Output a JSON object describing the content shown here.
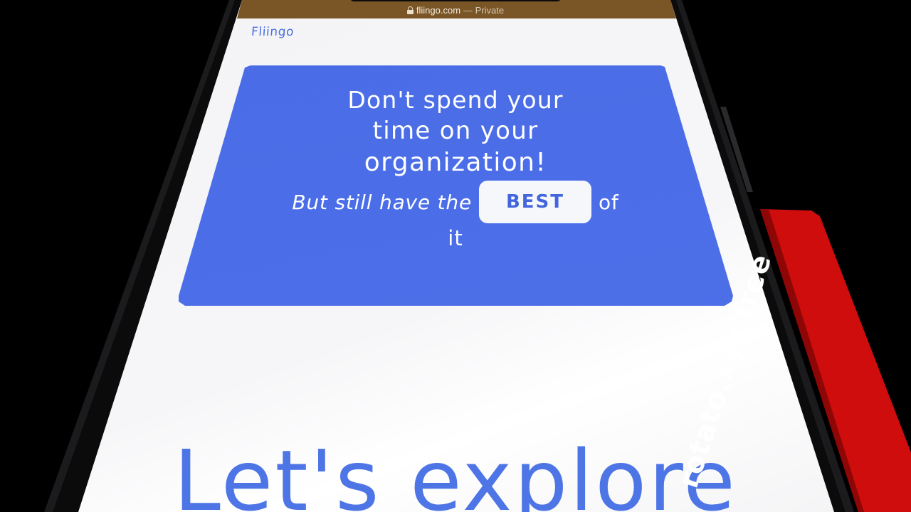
{
  "browser": {
    "domain": "fliingo.com",
    "mode_label": "— Private"
  },
  "site": {
    "brand": "Fliingo"
  },
  "hero": {
    "line1": "Don't spend your",
    "line2": "time on your",
    "line3": "organization!",
    "subline_pre": "But still have the",
    "badge": "BEST",
    "subline_post": "of",
    "subline_end": "it"
  },
  "cta": {
    "title": "Let's explore"
  },
  "promo": {
    "text": "rotato.xyz/free"
  },
  "colors": {
    "accent": "#4a6ce6",
    "status_bar": "#7a5526",
    "ribbon": "#cf0d0d",
    "badge_text": "#4466dd"
  }
}
